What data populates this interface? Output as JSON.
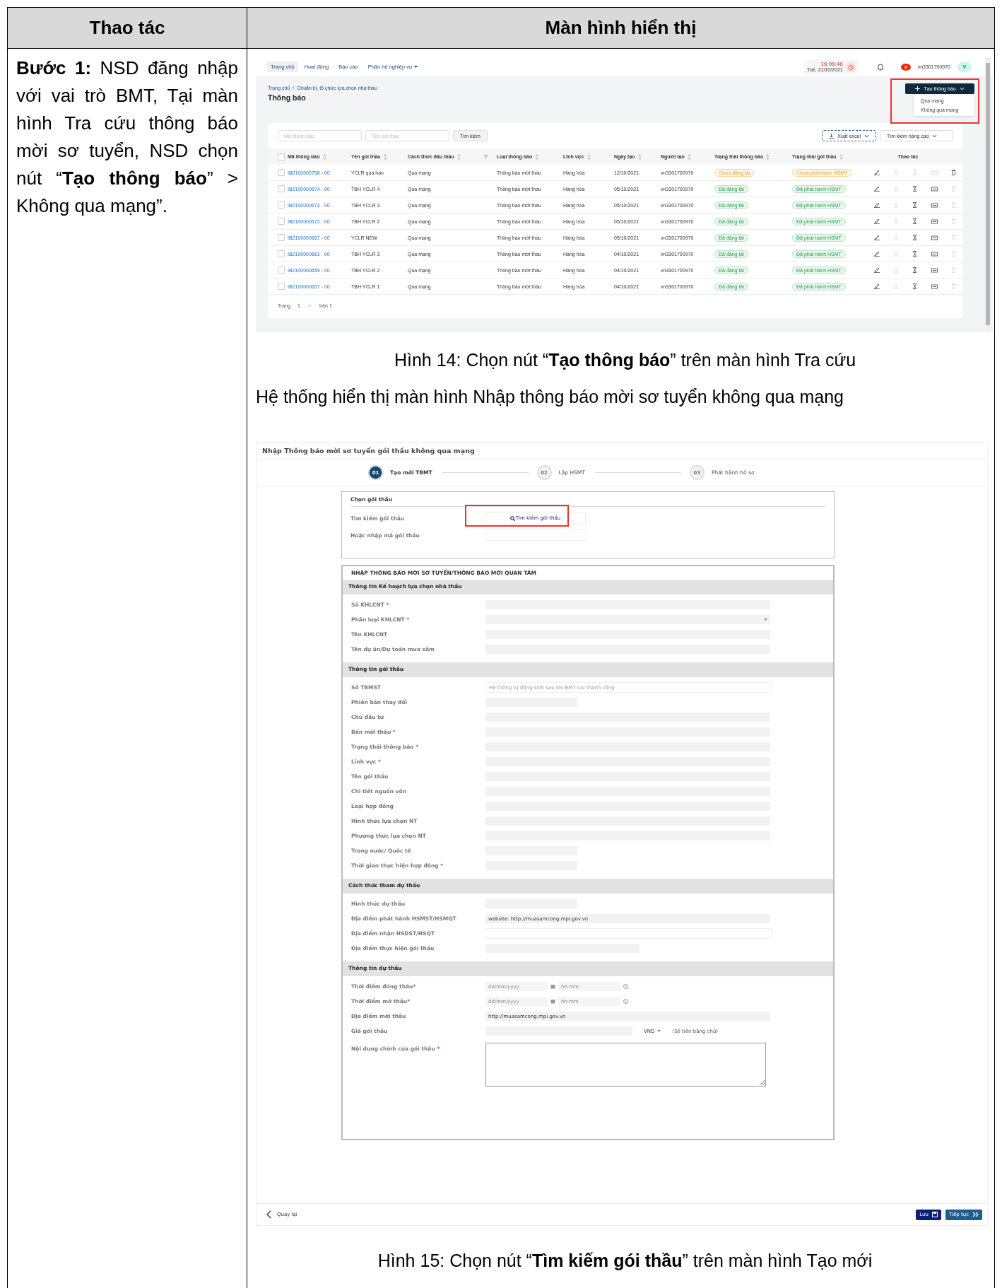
{
  "table_header": [
    "Thao tác",
    "Màn hình hiển thị"
  ],
  "step_text": "**Bước 1:** NSD đăng nhập với vai trò BMT, Tại màn hình Tra cứu thông báo mời sơ tuyển, NSD chọn nút “**Tạo thông báo**” > Không qua mạng”.",
  "screen1": {
    "nav": [
      {
        "label": "Trang chủ",
        "selected": true,
        "dropdown": false
      },
      {
        "label": "Hoạt động",
        "selected": false,
        "dropdown": false
      },
      {
        "label": "Báo cáo",
        "selected": false,
        "dropdown": false
      },
      {
        "label": "Phân hệ nghiệp vụ",
        "selected": false,
        "dropdown": true
      }
    ],
    "clock": {
      "time": "16:06:46",
      "date": "Tue, 21/10/2021"
    },
    "username": "vn3301700970",
    "avatar": "V",
    "breadcrumb": [
      "Trang chủ",
      "Chuẩn bị, tổ chức lựa chọn nhà thầu"
    ],
    "breadcrumb_separator": "/",
    "title": "Thông báo",
    "create_button": {
      "label": "Tạo thông báo",
      "expanded": true,
      "highlighted": true
    },
    "create_menu": [
      "Qua mạng",
      "Không qua mạng"
    ],
    "filters": [
      {
        "placeholder": "Mã thông báo"
      },
      {
        "placeholder": "Tên gói thầu"
      }
    ],
    "search_button": "Tìm kiếm",
    "export_button": "Xuất excel",
    "advanced_search": "Tìm kiếm nâng cao",
    "header_checked": false,
    "columns": [
      {
        "label": "Mã thông báo",
        "sortable": true,
        "filter": false
      },
      {
        "label": "Tên gói thầu",
        "sortable": true,
        "filter": false
      },
      {
        "label": "Cách thức đấu thầu",
        "sortable": true,
        "filter": true
      },
      {
        "label": "Loại thông báo",
        "sortable": true,
        "filter": false
      },
      {
        "label": "Lĩnh vực",
        "sortable": true,
        "filter": false
      },
      {
        "label": "Ngày tạo",
        "sortable": true,
        "filter": false
      },
      {
        "label": "Người tạo",
        "sortable": true,
        "filter": false
      },
      {
        "label": "Trạng thái thông báo",
        "sortable": true,
        "filter": false
      },
      {
        "label": "Trạng thái gói thầu",
        "sortable": true,
        "filter": false
      },
      {
        "label": "Thao tác",
        "sortable": false,
        "filter": false
      }
    ],
    "rows": [
      {
        "checked": false,
        "cells": [
          "IB2100000758 - 00",
          "YCLR qúa hạn",
          "Qua mạng",
          "Thông báo mời thầu",
          "Hàng hóa",
          "12/10/2021",
          "vn3301700970"
        ],
        "notice_status": {
          "label": "Chưa đăng tải",
          "kind": "pending"
        },
        "package_status": {
          "label": "Chưa phát hành HSMT",
          "kind": "pending"
        },
        "actions": [
          {
            "kind": "edit",
            "disabled": false
          },
          {
            "kind": "upload",
            "disabled": true
          },
          {
            "kind": "hourglass",
            "disabled": true
          },
          {
            "kind": "card",
            "disabled": true
          },
          {
            "kind": "delete",
            "disabled": false
          }
        ]
      },
      {
        "checked": false,
        "cells": [
          "IB2100000674 - 00",
          "TBH YCLR 4",
          "Qua mạng",
          "Thông báo mời thầu",
          "Hàng hóa",
          "05/10/2021",
          "vn3301700970"
        ],
        "notice_status": {
          "label": "Đã đăng tải",
          "kind": "done"
        },
        "package_status": {
          "label": "Đã phát hành HSMT",
          "kind": "done"
        },
        "actions": [
          {
            "kind": "edit",
            "disabled": false
          },
          {
            "kind": "upload",
            "disabled": true
          },
          {
            "kind": "hourglass",
            "disabled": false
          },
          {
            "kind": "card",
            "disabled": false
          },
          {
            "kind": "delete",
            "disabled": true
          }
        ]
      },
      {
        "checked": false,
        "cells": [
          "IB2100000673 - 00",
          "TBH YCLR 3",
          "Qua mạng",
          "Thông báo mời thầu",
          "Hàng hóa",
          "05/10/2021",
          "vn3301700970"
        ],
        "notice_status": {
          "label": "Đã đăng tải",
          "kind": "done"
        },
        "package_status": {
          "label": "Đã phát hành HSMT",
          "kind": "done"
        },
        "actions": [
          {
            "kind": "edit",
            "disabled": false
          },
          {
            "kind": "upload",
            "disabled": true
          },
          {
            "kind": "hourglass",
            "disabled": false
          },
          {
            "kind": "card",
            "disabled": false
          },
          {
            "kind": "delete",
            "disabled": true
          }
        ]
      },
      {
        "checked": false,
        "cells": [
          "IB2100000672 - 00",
          "TBH YCLR 2",
          "Qua mạng",
          "Thông báo mời thầu",
          "Hàng hóa",
          "05/10/2021",
          "vn3301700970"
        ],
        "notice_status": {
          "label": "Đã đăng tải",
          "kind": "done"
        },
        "package_status": {
          "label": "Đã phát hành HSMT",
          "kind": "done"
        },
        "actions": [
          {
            "kind": "edit",
            "disabled": false
          },
          {
            "kind": "upload",
            "disabled": true
          },
          {
            "kind": "hourglass",
            "disabled": false
          },
          {
            "kind": "card",
            "disabled": false
          },
          {
            "kind": "delete",
            "disabled": true
          }
        ]
      },
      {
        "checked": false,
        "cells": [
          "IB2100000667 - 00",
          "YCLR NEW",
          "Qua mạng",
          "Thông báo mời thầu",
          "Hàng hóa",
          "05/10/2021",
          "vn3301700970"
        ],
        "notice_status": {
          "label": "Đã đăng tải",
          "kind": "done"
        },
        "package_status": {
          "label": "Đã phát hành HSMT",
          "kind": "done"
        },
        "actions": [
          {
            "kind": "edit",
            "disabled": false
          },
          {
            "kind": "upload",
            "disabled": true
          },
          {
            "kind": "hourglass",
            "disabled": false
          },
          {
            "kind": "card",
            "disabled": false
          },
          {
            "kind": "delete",
            "disabled": true
          }
        ]
      },
      {
        "checked": false,
        "cells": [
          "IB2100000661 - 00",
          "TBH YCLR 3",
          "Qua mạng",
          "Thông báo mời thầu",
          "Hàng hóa",
          "04/10/2021",
          "vn3301700970"
        ],
        "notice_status": {
          "label": "Đã đăng tải",
          "kind": "done"
        },
        "package_status": {
          "label": "Đã phát hành HSMT",
          "kind": "done"
        },
        "actions": [
          {
            "kind": "edit",
            "disabled": false
          },
          {
            "kind": "upload",
            "disabled": true
          },
          {
            "kind": "hourglass",
            "disabled": false
          },
          {
            "kind": "card",
            "disabled": false
          },
          {
            "kind": "delete",
            "disabled": true
          }
        ]
      },
      {
        "checked": false,
        "cells": [
          "IB2100000659 - 00",
          "TBH YCLR 2",
          "Qua mạng",
          "Thông báo mời thầu",
          "Hàng hóa",
          "04/10/2021",
          "vn3301700970"
        ],
        "notice_status": {
          "label": "Đã đăng tải",
          "kind": "done"
        },
        "package_status": {
          "label": "Đã phát hành HSMT",
          "kind": "done"
        },
        "actions": [
          {
            "kind": "edit",
            "disabled": false
          },
          {
            "kind": "upload",
            "disabled": true
          },
          {
            "kind": "hourglass",
            "disabled": false
          },
          {
            "kind": "card",
            "disabled": false
          },
          {
            "kind": "delete",
            "disabled": true
          }
        ]
      },
      {
        "checked": false,
        "cells": [
          "IB2100000657 - 00",
          "TBH YCLR 1",
          "Qua mạng",
          "Thông báo mời thầu",
          "Hàng hóa",
          "04/10/2021",
          "vn3301700970"
        ],
        "notice_status": {
          "label": "Đã đăng tải",
          "kind": "done"
        },
        "package_status": {
          "label": "Đã phát hành HSMT",
          "kind": "done"
        },
        "actions": [
          {
            "kind": "edit",
            "disabled": false
          },
          {
            "kind": "upload",
            "disabled": true
          },
          {
            "kind": "hourglass",
            "disabled": false
          },
          {
            "kind": "card",
            "disabled": false
          },
          {
            "kind": "delete",
            "disabled": true
          }
        ]
      }
    ],
    "pagination": {
      "label": "Trang",
      "page": "1",
      "total": "trên 1"
    }
  },
  "caption1": "Hình 14: Chọn nút “**Tạo thông báo**” trên màn hình Tra cứu",
  "intro": "Hệ thống hiển thị màn hình Nhập thông báo mời sơ tuyển không qua mạng",
  "screen2": {
    "title": "Nhập Thông báo mời sơ tuyển gói thầu không qua mạng",
    "steps": [
      {
        "number": "01",
        "label": "Tạo mới TBMT",
        "selected": true
      },
      {
        "number": "02",
        "label": "Lập HSMT",
        "selected": false
      },
      {
        "number": "03",
        "label": "Phát hành hồ sơ",
        "selected": false
      }
    ],
    "package_box": {
      "title": "Chọn gói thầu",
      "search_label": "Tìm kiếm gói thầu",
      "search_button": "Tìm kiếm gói thầu",
      "search_highlighted": true,
      "code_label": "Hoặc nhập mã gói thầu"
    },
    "form_title": "NHẬP THÔNG BÁO MỜI SƠ TUYỂN/THÔNG BÁO MỜI QUAN TÂM",
    "sections": [
      {
        "title": "Thông tin Kế hoạch lựa chọn nhà thầu",
        "fields": [
          {
            "label": "Số KHLCNT *",
            "kind": "text"
          },
          {
            "label": "Phân loại KHLCNT *",
            "kind": "select"
          },
          {
            "label": "Tên KHLCNT",
            "kind": "text"
          },
          {
            "label": "Tên dự án/Dự toán mua sắm",
            "kind": "text"
          }
        ]
      },
      {
        "title": "Thông tin gói thầu",
        "fields": [
          {
            "label": "Số TBMST",
            "kind": "blank",
            "placeholder": "Hệ thống tự động sinh sau khi BMT lưu thành công"
          },
          {
            "label": "Phiên bản thay đổi",
            "kind": "short"
          },
          {
            "label": "Chủ đầu tư",
            "kind": "text"
          },
          {
            "label": "Bên mời thầu *",
            "kind": "text"
          },
          {
            "label": "Trạng thái thông báo *",
            "kind": "text"
          },
          {
            "label": "Lĩnh vực *",
            "kind": "text"
          },
          {
            "label": "Tên gói thầu",
            "kind": "text"
          },
          {
            "label": "Chi tiết nguồn vốn",
            "kind": "text"
          },
          {
            "label": "Loại hợp đồng",
            "kind": "text"
          },
          {
            "label": "Hình thức lựa chọn NT",
            "kind": "text"
          },
          {
            "label": "Phương thức lựa chọn NT",
            "kind": "text"
          },
          {
            "label": "Trong nước/ Quốc tế",
            "kind": "short"
          },
          {
            "label": "Thời gian thực hiện hợp đồng *",
            "kind": "short"
          }
        ]
      },
      {
        "title": "Cách thức tham dự thầu",
        "fields": [
          {
            "label": "Hình thức dự thầu",
            "kind": "short"
          },
          {
            "label": "Địa điểm phát hành HSMST/HSMQT",
            "kind": "text",
            "value": "website: http://muasamcong.mpi.gov.vn"
          },
          {
            "label": "Địa điểm nhận HSDST/HSQT",
            "kind": "blank"
          },
          {
            "label": "Địa điểm thực hiện gói thầu",
            "kind": "medium"
          }
        ]
      },
      {
        "title": "Thông tin dự thầu",
        "fields": [
          {
            "label": "Thời điểm đóng thầu*",
            "kind": "datetime",
            "date_placeholder": "dd/mm/yyyy",
            "time_placeholder": "hh:mm"
          },
          {
            "label": "Thời điểm mở thầu*",
            "kind": "datetime",
            "date_placeholder": "dd/mm/yyyy",
            "time_placeholder": "hh:mm"
          },
          {
            "label": "Địa điểm mời thầu",
            "kind": "text",
            "value": "http://muasamcong.mpi.gov.vn"
          },
          {
            "label": "Giá gói thầu",
            "kind": "money",
            "currency": "VND",
            "hint": "(Số tiền bằng chữ)"
          },
          {
            "label": "Nội dung chính của gói thầu",
            "required_mark": "*",
            "kind": "textarea"
          }
        ]
      }
    ],
    "back_button": "Quay lại",
    "save_button": "Lưu",
    "next_button": "Tiếp tục"
  },
  "caption2": "Hình 15: Chọn nút “**Tìm kiếm gói thầu**” trên màn hình Tạo mới"
}
